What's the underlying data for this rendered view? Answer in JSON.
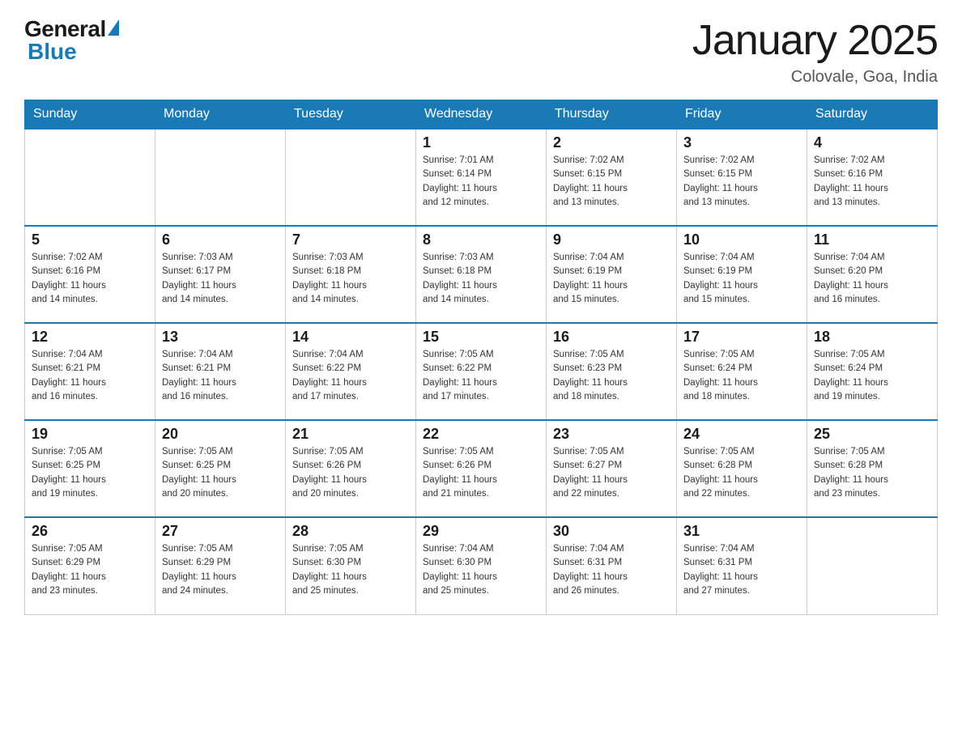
{
  "header": {
    "logo_general": "General",
    "logo_blue": "Blue",
    "title": "January 2025",
    "subtitle": "Colovale, Goa, India"
  },
  "days_of_week": [
    "Sunday",
    "Monday",
    "Tuesday",
    "Wednesday",
    "Thursday",
    "Friday",
    "Saturday"
  ],
  "weeks": [
    [
      {
        "day": "",
        "info": ""
      },
      {
        "day": "",
        "info": ""
      },
      {
        "day": "",
        "info": ""
      },
      {
        "day": "1",
        "info": "Sunrise: 7:01 AM\nSunset: 6:14 PM\nDaylight: 11 hours\nand 12 minutes."
      },
      {
        "day": "2",
        "info": "Sunrise: 7:02 AM\nSunset: 6:15 PM\nDaylight: 11 hours\nand 13 minutes."
      },
      {
        "day": "3",
        "info": "Sunrise: 7:02 AM\nSunset: 6:15 PM\nDaylight: 11 hours\nand 13 minutes."
      },
      {
        "day": "4",
        "info": "Sunrise: 7:02 AM\nSunset: 6:16 PM\nDaylight: 11 hours\nand 13 minutes."
      }
    ],
    [
      {
        "day": "5",
        "info": "Sunrise: 7:02 AM\nSunset: 6:16 PM\nDaylight: 11 hours\nand 14 minutes."
      },
      {
        "day": "6",
        "info": "Sunrise: 7:03 AM\nSunset: 6:17 PM\nDaylight: 11 hours\nand 14 minutes."
      },
      {
        "day": "7",
        "info": "Sunrise: 7:03 AM\nSunset: 6:18 PM\nDaylight: 11 hours\nand 14 minutes."
      },
      {
        "day": "8",
        "info": "Sunrise: 7:03 AM\nSunset: 6:18 PM\nDaylight: 11 hours\nand 14 minutes."
      },
      {
        "day": "9",
        "info": "Sunrise: 7:04 AM\nSunset: 6:19 PM\nDaylight: 11 hours\nand 15 minutes."
      },
      {
        "day": "10",
        "info": "Sunrise: 7:04 AM\nSunset: 6:19 PM\nDaylight: 11 hours\nand 15 minutes."
      },
      {
        "day": "11",
        "info": "Sunrise: 7:04 AM\nSunset: 6:20 PM\nDaylight: 11 hours\nand 16 minutes."
      }
    ],
    [
      {
        "day": "12",
        "info": "Sunrise: 7:04 AM\nSunset: 6:21 PM\nDaylight: 11 hours\nand 16 minutes."
      },
      {
        "day": "13",
        "info": "Sunrise: 7:04 AM\nSunset: 6:21 PM\nDaylight: 11 hours\nand 16 minutes."
      },
      {
        "day": "14",
        "info": "Sunrise: 7:04 AM\nSunset: 6:22 PM\nDaylight: 11 hours\nand 17 minutes."
      },
      {
        "day": "15",
        "info": "Sunrise: 7:05 AM\nSunset: 6:22 PM\nDaylight: 11 hours\nand 17 minutes."
      },
      {
        "day": "16",
        "info": "Sunrise: 7:05 AM\nSunset: 6:23 PM\nDaylight: 11 hours\nand 18 minutes."
      },
      {
        "day": "17",
        "info": "Sunrise: 7:05 AM\nSunset: 6:24 PM\nDaylight: 11 hours\nand 18 minutes."
      },
      {
        "day": "18",
        "info": "Sunrise: 7:05 AM\nSunset: 6:24 PM\nDaylight: 11 hours\nand 19 minutes."
      }
    ],
    [
      {
        "day": "19",
        "info": "Sunrise: 7:05 AM\nSunset: 6:25 PM\nDaylight: 11 hours\nand 19 minutes."
      },
      {
        "day": "20",
        "info": "Sunrise: 7:05 AM\nSunset: 6:25 PM\nDaylight: 11 hours\nand 20 minutes."
      },
      {
        "day": "21",
        "info": "Sunrise: 7:05 AM\nSunset: 6:26 PM\nDaylight: 11 hours\nand 20 minutes."
      },
      {
        "day": "22",
        "info": "Sunrise: 7:05 AM\nSunset: 6:26 PM\nDaylight: 11 hours\nand 21 minutes."
      },
      {
        "day": "23",
        "info": "Sunrise: 7:05 AM\nSunset: 6:27 PM\nDaylight: 11 hours\nand 22 minutes."
      },
      {
        "day": "24",
        "info": "Sunrise: 7:05 AM\nSunset: 6:28 PM\nDaylight: 11 hours\nand 22 minutes."
      },
      {
        "day": "25",
        "info": "Sunrise: 7:05 AM\nSunset: 6:28 PM\nDaylight: 11 hours\nand 23 minutes."
      }
    ],
    [
      {
        "day": "26",
        "info": "Sunrise: 7:05 AM\nSunset: 6:29 PM\nDaylight: 11 hours\nand 23 minutes."
      },
      {
        "day": "27",
        "info": "Sunrise: 7:05 AM\nSunset: 6:29 PM\nDaylight: 11 hours\nand 24 minutes."
      },
      {
        "day": "28",
        "info": "Sunrise: 7:05 AM\nSunset: 6:30 PM\nDaylight: 11 hours\nand 25 minutes."
      },
      {
        "day": "29",
        "info": "Sunrise: 7:04 AM\nSunset: 6:30 PM\nDaylight: 11 hours\nand 25 minutes."
      },
      {
        "day": "30",
        "info": "Sunrise: 7:04 AM\nSunset: 6:31 PM\nDaylight: 11 hours\nand 26 minutes."
      },
      {
        "day": "31",
        "info": "Sunrise: 7:04 AM\nSunset: 6:31 PM\nDaylight: 11 hours\nand 27 minutes."
      },
      {
        "day": "",
        "info": ""
      }
    ]
  ]
}
